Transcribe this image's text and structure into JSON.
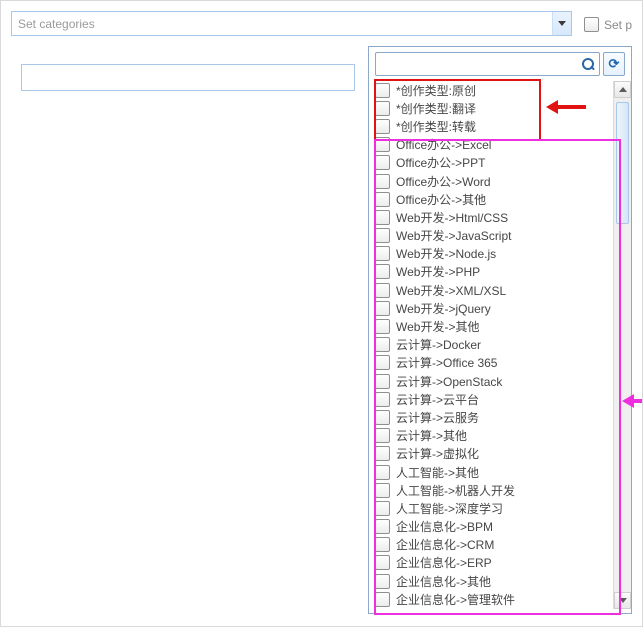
{
  "topbar": {
    "combo_placeholder": "Set categories",
    "setp_label": "Set p"
  },
  "panel": {
    "filter_value": "",
    "refresh_glyph": "⟳"
  },
  "items": [
    {
      "label": "*创作类型:原创"
    },
    {
      "label": "*创作类型:翻译"
    },
    {
      "label": "*创作类型:转载"
    },
    {
      "label": "Office办公->Excel"
    },
    {
      "label": "Office办公->PPT"
    },
    {
      "label": "Office办公->Word"
    },
    {
      "label": "Office办公->其他"
    },
    {
      "label": "Web开发->Html/CSS"
    },
    {
      "label": "Web开发->JavaScript"
    },
    {
      "label": "Web开发->Node.js"
    },
    {
      "label": "Web开发->PHP"
    },
    {
      "label": "Web开发->XML/XSL"
    },
    {
      "label": "Web开发->jQuery"
    },
    {
      "label": "Web开发->其他"
    },
    {
      "label": "云计算->Docker"
    },
    {
      "label": "云计算->Office 365"
    },
    {
      "label": "云计算->OpenStack"
    },
    {
      "label": "云计算->云平台"
    },
    {
      "label": "云计算->云服务"
    },
    {
      "label": "云计算->其他"
    },
    {
      "label": "云计算->虚拟化"
    },
    {
      "label": "人工智能->其他"
    },
    {
      "label": "人工智能->机器人开发"
    },
    {
      "label": "人工智能->深度学习"
    },
    {
      "label": "企业信息化->BPM"
    },
    {
      "label": "企业信息化->CRM"
    },
    {
      "label": "企业信息化->ERP"
    },
    {
      "label": "企业信息化->其他"
    },
    {
      "label": "企业信息化->管理软件"
    }
  ]
}
